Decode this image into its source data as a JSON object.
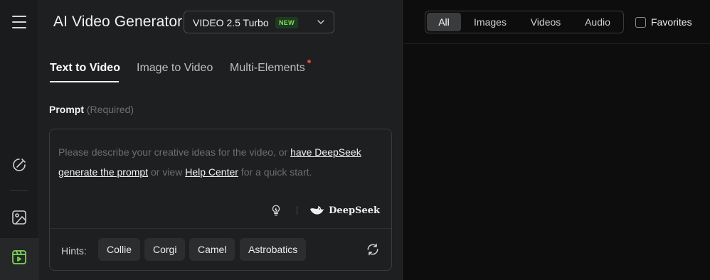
{
  "app": {
    "title": "AI Video Generator"
  },
  "model_selector": {
    "name": "VIDEO 2.5 Turbo",
    "badge": "NEW"
  },
  "tabs": [
    {
      "label": "Text to Video",
      "active": true
    },
    {
      "label": "Image to Video",
      "active": false
    },
    {
      "label": "Multi-Elements",
      "active": false
    }
  ],
  "prompt": {
    "label": "Prompt",
    "required": "(Required)",
    "placeholder_1": "Please describe your creative ideas for the video, or ",
    "link_deepseek_1": "have DeepSeek",
    "link_deepseek_2": "generate the prompt",
    "placeholder_2": " or view ",
    "link_help": "Help Center",
    "placeholder_3": " for a quick start.",
    "deepseek_label": "DeepSeek"
  },
  "hints": {
    "label": "Hints:",
    "chips": [
      "Collie",
      "Corgi",
      "Camel",
      "Astrobatics"
    ]
  },
  "filters": {
    "items": [
      "All",
      "Images",
      "Videos",
      "Audio"
    ],
    "active": "All"
  },
  "favorites": {
    "label": "Favorites",
    "checked": false
  },
  "colors": {
    "accent_green": "#7ed957",
    "notification_dot": "#e0443c",
    "panel_bg": "#1e1f20"
  },
  "icons": {
    "rail": [
      "menu-icon",
      "magic-edit-icon",
      "image-icon",
      "video-icon"
    ],
    "prompt_tools": [
      "lightbulb-icon",
      "deepseek-whale-icon"
    ],
    "hints_refresh": "refresh-icon"
  }
}
